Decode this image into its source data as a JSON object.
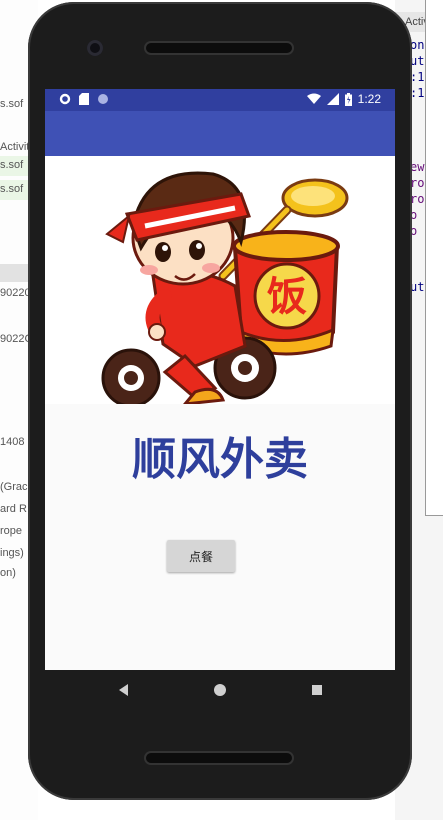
{
  "ide": {
    "tab_label": "Activ",
    "left_lines": [
      {
        "text": "s.sof",
        "hl": false
      },
      {
        "text": "Activit",
        "hl": false
      },
      {
        "text": "s.sof",
        "hl": true
      },
      {
        "text": "s.sof",
        "hl": true
      },
      {
        "text": "90220",
        "hl": false
      },
      {
        "text": "9022C",
        "hl": false
      },
      {
        "text": "1408",
        "hl": false
      },
      {
        "text": "(Grac",
        "hl": false
      },
      {
        "text": "ard R",
        "hl": false
      },
      {
        "text": "rope",
        "hl": false
      },
      {
        "text": "ings)",
        "hl": false
      },
      {
        "text": "on)",
        "hl": false
      }
    ],
    "right_lines": [
      "on",
      "ut",
      ":1",
      ":1",
      "ew",
      "ro",
      "ro",
      "o",
      "o",
      "ut"
    ]
  },
  "status_bar": {
    "time": "1:22",
    "left_icons": [
      "gear-icon",
      "sd-card-icon",
      "sync-circle-icon"
    ],
    "right_icons": [
      "wifi-icon",
      "cell-signal-icon",
      "battery-icon"
    ]
  },
  "main": {
    "banner_image": "delivery-boy-cartoon",
    "banner_character": "饭",
    "title": "顺风外卖",
    "order_button_label": "点餐"
  },
  "nav": {
    "buttons": [
      "back-icon",
      "home-icon",
      "recents-icon"
    ]
  },
  "colors": {
    "status_bar": "#303f9f",
    "app_bar": "#3f51b5",
    "title": "#2e3f9c",
    "button_bg": "#d6d6d6"
  }
}
